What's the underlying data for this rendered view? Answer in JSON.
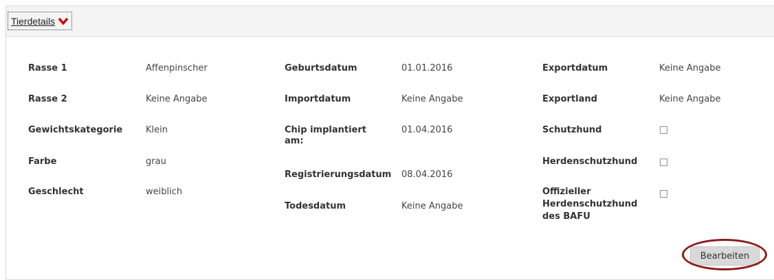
{
  "panel": {
    "title": "Tierdetails",
    "toggle_icon": "chevron-down-icon",
    "toggle_icon_color": "#cc0000"
  },
  "details": {
    "rasse1_label": "Rasse 1",
    "rasse1_value": "Affenpinscher",
    "rasse2_label": "Rasse 2",
    "rasse2_value": "Keine Angabe",
    "gewichtskategorie_label": "Gewichtskategorie",
    "gewichtskategorie_value": "Klein",
    "farbe_label": "Farbe",
    "farbe_value": "grau",
    "geschlecht_label": "Geschlecht",
    "geschlecht_value": "weiblich",
    "geburtsdatum_label": "Geburtsdatum",
    "geburtsdatum_value": "01.01.2016",
    "importdatum_label": "Importdatum",
    "importdatum_value": "Keine Angabe",
    "chip_label_line1": "Chip implantiert",
    "chip_label_line2": "am:",
    "chip_value": "01.04.2016",
    "registrierungsdatum_label": "Registrierungsdatum",
    "registrierungsdatum_value": "08.04.2016",
    "todesdatum_label": "Todesdatum",
    "todesdatum_value": "Keine Angabe",
    "exportdatum_label": "Exportdatum",
    "exportdatum_value": "Keine Angabe",
    "exportland_label": "Exportland",
    "exportland_value": "Keine Angabe",
    "schutzhund_label": "Schutzhund",
    "schutzhund_checked": false,
    "herdenschutzhund_label": "Herdenschutzhund",
    "herdenschutzhund_checked": false,
    "offiziell_label_line1": "Offizieller",
    "offiziell_label_line2": "Herdenschutzhund",
    "offiziell_label_line3": "des BAFU",
    "offiziell_checked": false
  },
  "actions": {
    "edit_label": "Bearbeiten",
    "highlight_color": "#8b1a1a"
  }
}
